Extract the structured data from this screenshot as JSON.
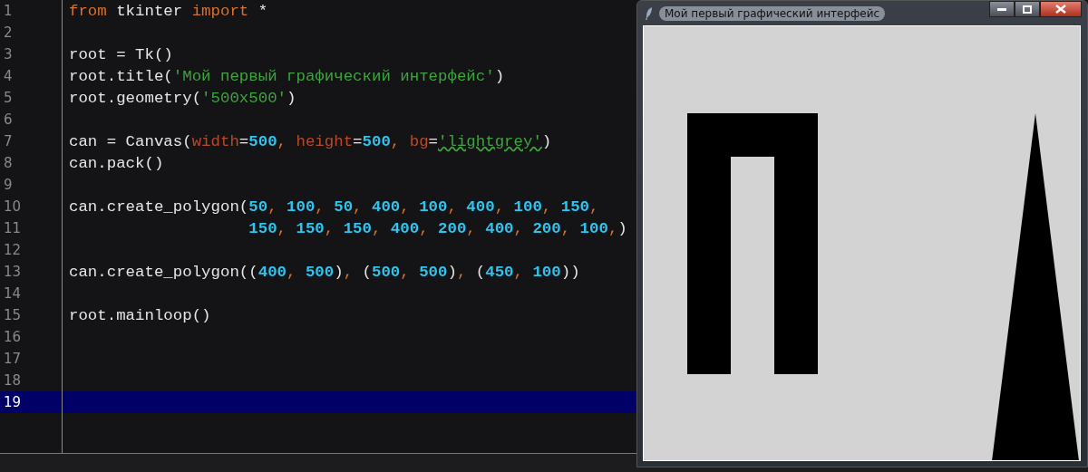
{
  "editor": {
    "lines": [
      {
        "number": "1",
        "selected": false,
        "tokens": [
          {
            "kind": "keyword",
            "text": "from"
          },
          {
            "kind": "plain",
            "text": " tkinter "
          },
          {
            "kind": "keyword",
            "text": "import"
          },
          {
            "kind": "plain",
            "text": " *"
          }
        ]
      },
      {
        "number": "2",
        "selected": false
      },
      {
        "number": "3",
        "selected": false,
        "tokens": [
          {
            "kind": "plain",
            "text": "root = Tk()"
          }
        ]
      },
      {
        "number": "4",
        "selected": false,
        "tokens": [
          {
            "kind": "plain",
            "text": "root.title("
          },
          {
            "kind": "string",
            "text": "'Мой первый графический интерфейс'"
          },
          {
            "kind": "plain",
            "text": ")"
          }
        ]
      },
      {
        "number": "5",
        "selected": false,
        "tokens": [
          {
            "kind": "plain",
            "text": "root.geometry("
          },
          {
            "kind": "string",
            "text": "'500x500'"
          },
          {
            "kind": "plain",
            "text": ")"
          }
        ]
      },
      {
        "number": "6",
        "selected": false
      },
      {
        "number": "7",
        "selected": false,
        "tokens": [
          {
            "kind": "plain",
            "text": "can = Canvas("
          },
          {
            "kind": "param",
            "text": "width"
          },
          {
            "kind": "plain",
            "text": "="
          },
          {
            "kind": "number",
            "text": "500"
          },
          {
            "kind": "punct",
            "text": ", "
          },
          {
            "kind": "param",
            "text": "height"
          },
          {
            "kind": "plain",
            "text": "="
          },
          {
            "kind": "number",
            "text": "500"
          },
          {
            "kind": "punct",
            "text": ", "
          },
          {
            "kind": "param",
            "text": "bg"
          },
          {
            "kind": "plain",
            "text": "="
          },
          {
            "kind": "string",
            "text": "'lightgrey'",
            "underlined": true
          },
          {
            "kind": "plain",
            "text": ")"
          }
        ]
      },
      {
        "number": "8",
        "selected": false,
        "tokens": [
          {
            "kind": "plain",
            "text": "can.pack()"
          }
        ]
      },
      {
        "number": "9",
        "selected": false
      },
      {
        "number": "10",
        "selected": false,
        "tokens": [
          {
            "kind": "plain",
            "text": "can.create_polygon("
          },
          {
            "kind": "number",
            "text": "50"
          },
          {
            "kind": "punct",
            "text": ", "
          },
          {
            "kind": "number",
            "text": "100"
          },
          {
            "kind": "punct",
            "text": ", "
          },
          {
            "kind": "number",
            "text": "50"
          },
          {
            "kind": "punct",
            "text": ", "
          },
          {
            "kind": "number",
            "text": "400"
          },
          {
            "kind": "punct",
            "text": ", "
          },
          {
            "kind": "number",
            "text": "100"
          },
          {
            "kind": "punct",
            "text": ", "
          },
          {
            "kind": "number",
            "text": "400"
          },
          {
            "kind": "punct",
            "text": ", "
          },
          {
            "kind": "number",
            "text": "100"
          },
          {
            "kind": "punct",
            "text": ", "
          },
          {
            "kind": "number",
            "text": "150"
          },
          {
            "kind": "punct",
            "text": ","
          }
        ]
      },
      {
        "number": "11",
        "selected": false,
        "indented": true,
        "tokens": [
          {
            "kind": "number",
            "text": "150"
          },
          {
            "kind": "punct",
            "text": ", "
          },
          {
            "kind": "number",
            "text": "150"
          },
          {
            "kind": "punct",
            "text": ", "
          },
          {
            "kind": "number",
            "text": "150"
          },
          {
            "kind": "punct",
            "text": ", "
          },
          {
            "kind": "number",
            "text": "400"
          },
          {
            "kind": "punct",
            "text": ", "
          },
          {
            "kind": "number",
            "text": "200"
          },
          {
            "kind": "punct",
            "text": ", "
          },
          {
            "kind": "number",
            "text": "400"
          },
          {
            "kind": "punct",
            "text": ", "
          },
          {
            "kind": "number",
            "text": "200"
          },
          {
            "kind": "punct",
            "text": ", "
          },
          {
            "kind": "number",
            "text": "100"
          },
          {
            "kind": "punct",
            "text": ","
          },
          {
            "kind": "plain",
            "text": ")"
          }
        ]
      },
      {
        "number": "12",
        "selected": false
      },
      {
        "number": "13",
        "selected": false,
        "tokens": [
          {
            "kind": "plain",
            "text": "can.create_polygon(("
          },
          {
            "kind": "number",
            "text": "400"
          },
          {
            "kind": "punct",
            "text": ", "
          },
          {
            "kind": "number",
            "text": "500"
          },
          {
            "kind": "plain",
            "text": ")"
          },
          {
            "kind": "punct",
            "text": ", "
          },
          {
            "kind": "plain",
            "text": "("
          },
          {
            "kind": "number",
            "text": "500"
          },
          {
            "kind": "punct",
            "text": ", "
          },
          {
            "kind": "number",
            "text": "500"
          },
          {
            "kind": "plain",
            "text": ")"
          },
          {
            "kind": "punct",
            "text": ", "
          },
          {
            "kind": "plain",
            "text": "("
          },
          {
            "kind": "number",
            "text": "450"
          },
          {
            "kind": "punct",
            "text": ", "
          },
          {
            "kind": "number",
            "text": "100"
          },
          {
            "kind": "plain",
            "text": "))"
          }
        ]
      },
      {
        "number": "14",
        "selected": false
      },
      {
        "number": "15",
        "selected": false,
        "tokens": [
          {
            "kind": "plain",
            "text": "root.mainloop()"
          }
        ]
      },
      {
        "number": "16",
        "selected": false
      },
      {
        "number": "17",
        "selected": false
      },
      {
        "number": "18",
        "selected": false
      },
      {
        "number": "19",
        "selected": true
      }
    ]
  },
  "window": {
    "title": "Мой первый графический интерфейс"
  }
}
